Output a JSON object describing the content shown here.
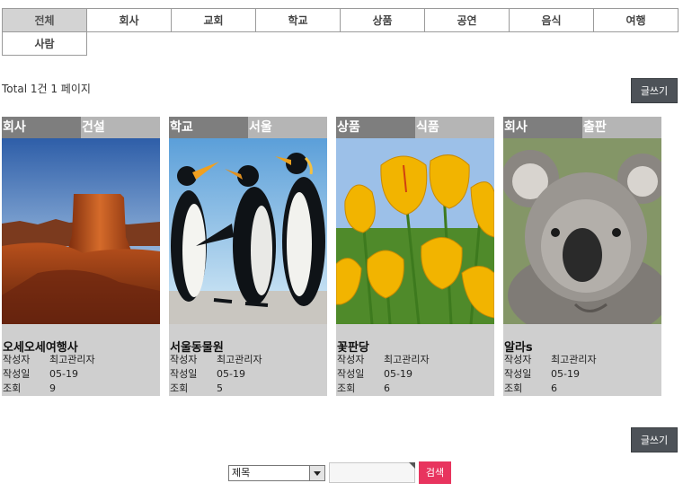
{
  "categories": [
    "전체",
    "회사",
    "교회",
    "학교",
    "상품",
    "공연",
    "음식",
    "여행",
    "사람"
  ],
  "total_text": "Total 1건 1 페이지",
  "write_label": "글쓰기",
  "cards": [
    {
      "tag1": "회사",
      "tag2": "건설",
      "title": "오세오세여행사",
      "author_label": "작성자",
      "author": "최고관리자",
      "date_label": "작성일",
      "date": "05-19",
      "views_label": "조회",
      "views": "9"
    },
    {
      "tag1": "학교",
      "tag2": "서울",
      "title": "서울동물원",
      "author_label": "작성자",
      "author": "최고관리자",
      "date_label": "작성일",
      "date": "05-19",
      "views_label": "조회",
      "views": "5"
    },
    {
      "tag1": "상품",
      "tag2": "식품",
      "title": "꽃판당",
      "author_label": "작성자",
      "author": "최고관리자",
      "date_label": "작성일",
      "date": "05-19",
      "views_label": "조회",
      "views": "6"
    },
    {
      "tag1": "회사",
      "tag2": "출판",
      "title": "알라s",
      "author_label": "작성자",
      "author": "최고관리자",
      "date_label": "작성일",
      "date": "05-19",
      "views_label": "조회",
      "views": "6"
    }
  ],
  "search": {
    "field_value": "제목",
    "query": "",
    "button_label": "검색"
  },
  "colors": {
    "write_button": "#4d5258",
    "search_button": "#e8345e",
    "tag_primary": "#7e7e7e",
    "tag_secondary": "#b5b5b5",
    "card_bg": "#cfcfcf"
  }
}
